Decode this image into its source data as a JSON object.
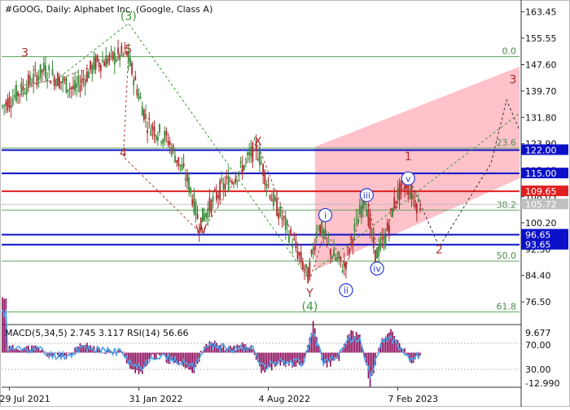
{
  "chart_data": {
    "type": "candlestick",
    "symbol_header": "#GOOG, Daily:",
    "title": "Alphabet Inc. (Google, Class A)",
    "price_axis": {
      "ylim": [
        70.18,
        166.25
      ],
      "ticks": [
        "163.45",
        "155.55",
        "147.60",
        "139.70",
        "131.80",
        "123.90",
        "115.95",
        "108.05",
        "100.20",
        "92.30",
        "84.40",
        "76.50"
      ]
    },
    "x_axis": {
      "labels": [
        {
          "text": "29 Jul 2021",
          "bar": 1
        },
        {
          "text": "31 Jan 2022",
          "bar": 26
        },
        {
          "text": "4 Aug 2022",
          "bar": 51
        },
        {
          "text": "7 Feb 2023",
          "bar": 76
        }
      ],
      "bar_count": 100
    },
    "horizontal_levels": [
      {
        "price": 122.0,
        "label": "122.00",
        "color": "#0b10c8",
        "boxed": true
      },
      {
        "price": 115.0,
        "label": "115.00",
        "color": "#0b10c8",
        "boxed": true
      },
      {
        "price": 109.65,
        "label": "109.65",
        "color": "#e02020",
        "boxed": true
      },
      {
        "price": 105.72,
        "label": "105.72",
        "color": "#c0c0c0",
        "boxed": true
      },
      {
        "price": 96.65,
        "label": "96.65",
        "color": "#0b10c8",
        "boxed": true
      },
      {
        "price": 93.65,
        "label": "93.65",
        "color": "#0b10c8",
        "boxed": true
      }
    ],
    "fibonacci_levels": [
      {
        "label": "0.0",
        "price": 150.0
      },
      {
        "label": "23.6",
        "price": 122.6
      },
      {
        "label": "38.2",
        "price": 104.0
      },
      {
        "label": "50.0",
        "price": 88.7
      },
      {
        "label": "61.8",
        "price": 73.5
      }
    ],
    "wave_labels": [
      {
        "text": "(3)",
        "bar": 24,
        "price": 161.0,
        "color": "#3a9a3a"
      },
      {
        "text": "3",
        "bar": 4,
        "price": 150.0,
        "color": "#a83030"
      },
      {
        "text": "5",
        "bar": 24,
        "price": 151.0,
        "color": "#a83030"
      },
      {
        "text": "4",
        "bar": 23,
        "price": 120.0,
        "color": "#a83030"
      },
      {
        "text": "X",
        "bar": 49,
        "price": 123.5,
        "color": "#a83030"
      },
      {
        "text": "W",
        "bar": 38,
        "price": 97.0,
        "color": "#a83030"
      },
      {
        "text": "Y",
        "bar": 59,
        "price": 78.0,
        "color": "#a83030"
      },
      {
        "text": "(4)",
        "bar": 59,
        "price": 74.0,
        "color": "#3a9a3a"
      },
      {
        "text": "1",
        "bar": 78,
        "price": 119.0,
        "color": "#a83030"
      },
      {
        "text": "2",
        "bar": 84,
        "price": 91.0,
        "color": "#a83030"
      },
      {
        "text": "3",
        "bar": 108,
        "price": 142.0,
        "color": "#a83030"
      }
    ],
    "circled_labels": [
      {
        "text": "i",
        "bar": 62,
        "price": 102.5
      },
      {
        "text": "ii",
        "bar": 66,
        "price": 80.0
      },
      {
        "text": "iii",
        "bar": 70,
        "price": 108.5
      },
      {
        "text": "iv",
        "bar": 72,
        "price": 86.5
      },
      {
        "text": "v",
        "bar": 78,
        "price": 113.5
      }
    ],
    "macd": {
      "label": "MACD(5,34,5) 2.745 3.117 RSI(14) 56.66",
      "ylim": [
        -12.99,
        9.677
      ],
      "ticks": [
        "9.677",
        "70.00",
        "30.00",
        "-12.990"
      ]
    },
    "colors": {
      "bull": "#3a8a3a",
      "bear": "#b02a2a",
      "fib_line": "#5aa55a",
      "channel": "#ffb6c1",
      "rsi": "#4aa3e8",
      "macd_hist": "#8b0a5a"
    }
  }
}
